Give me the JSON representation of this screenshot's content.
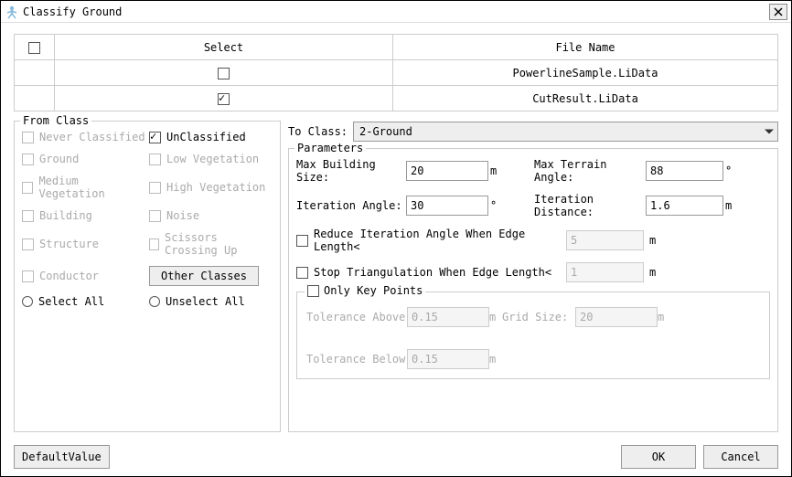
{
  "window": {
    "title": "Classify Ground"
  },
  "table": {
    "headers": {
      "select": "Select",
      "filename": "File Name"
    },
    "rows": [
      {
        "checked": false,
        "filename": "PowerlineSample.LiData"
      },
      {
        "checked": true,
        "filename": "CutResult.LiData"
      }
    ]
  },
  "fromClass": {
    "legend": "From Class",
    "items": {
      "never": "Never Classified",
      "unclassified": "UnClassified",
      "ground": "Ground",
      "lowveg": "Low Vegetation",
      "medveg": "Medium Vegetation",
      "highveg": "High Vegetation",
      "building": "Building",
      "noise": "Noise",
      "structure": "Structure",
      "scissors": "Scissors Crossing Up",
      "conductor": "Conductor"
    },
    "otherClasses": "Other Classes",
    "selectAll": "Select All",
    "unselectAll": "Unselect All"
  },
  "toClass": {
    "label": "To Class:",
    "value": "2-Ground"
  },
  "params": {
    "legend": "Parameters",
    "maxBuildingSize": {
      "label": "Max Building Size:",
      "value": "20",
      "unit": "m"
    },
    "maxTerrainAngle": {
      "label": "Max Terrain Angle:",
      "value": "88",
      "unit": "°"
    },
    "iterationAngle": {
      "label": "Iteration Angle:",
      "value": "30",
      "unit": "°"
    },
    "iterationDistance": {
      "label": "Iteration Distance:",
      "value": "1.6",
      "unit": "m"
    },
    "reduceIter": {
      "label": "Reduce Iteration Angle When Edge Length<",
      "value": "5",
      "unit": "m"
    },
    "stopTri": {
      "label": "Stop Triangulation When Edge Length<",
      "value": "1",
      "unit": "m"
    },
    "onlyKeyPoints": {
      "legend": "Only Key Points",
      "toleranceAbove": {
        "label": "Tolerance Above",
        "value": "0.15",
        "unit": "m"
      },
      "gridSize": {
        "label": "Grid Size:",
        "value": "20",
        "unit": "m"
      },
      "toleranceBelow": {
        "label": "Tolerance Below",
        "value": "0.15",
        "unit": "m"
      }
    }
  },
  "buttons": {
    "defaultValue": "DefaultValue",
    "ok": "OK",
    "cancel": "Cancel"
  }
}
